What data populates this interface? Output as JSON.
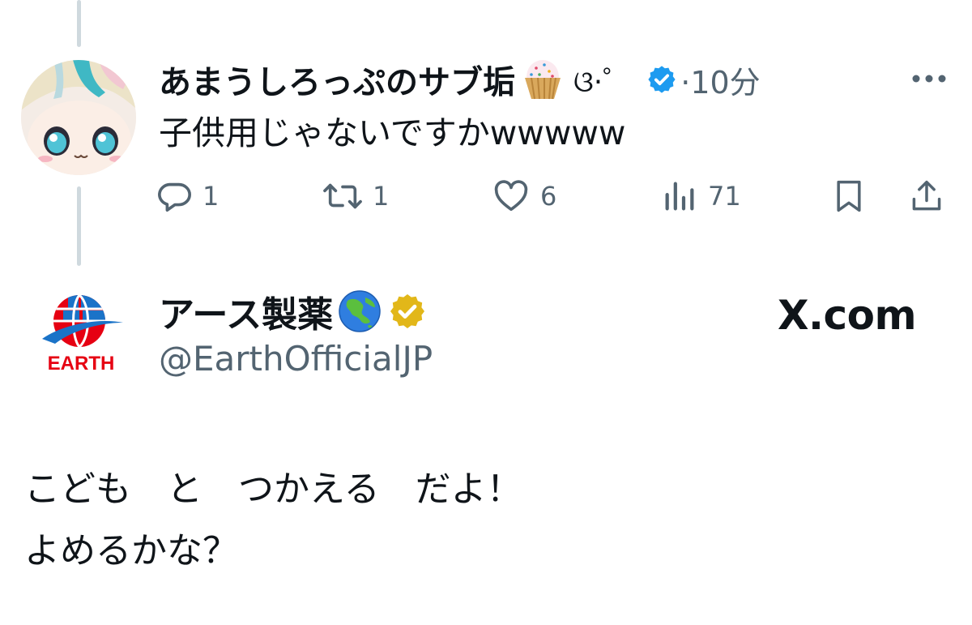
{
  "reply": {
    "display_name": "あまうしろっぷのサブ垢",
    "name_emoji": "cupcake-emoji",
    "name_suffix": "ଓ·゜",
    "verified": "blue",
    "timestamp": "·10分",
    "text": "子供用じゃないですかwwwww",
    "actions": {
      "reply_count": "1",
      "repost_count": "1",
      "like_count": "6",
      "view_count": "71"
    }
  },
  "quoted": {
    "logo_text": "EARTH",
    "display_name": "アース製薬",
    "name_emoji": "globe-asia-emoji",
    "verified": "gold",
    "handle": "@EarthOfficialJP",
    "source": "X.com",
    "body": "こども　と　つかえる　だよ！\nよめるかな？"
  },
  "colors": {
    "text_primary": "#0f1419",
    "text_secondary": "#536471",
    "thread_line": "#cfd9de",
    "verified_blue": "#1d9bf0",
    "verified_gold": "#e2b719",
    "earth_red": "#e60012",
    "earth_blue": "#1a73c8"
  }
}
